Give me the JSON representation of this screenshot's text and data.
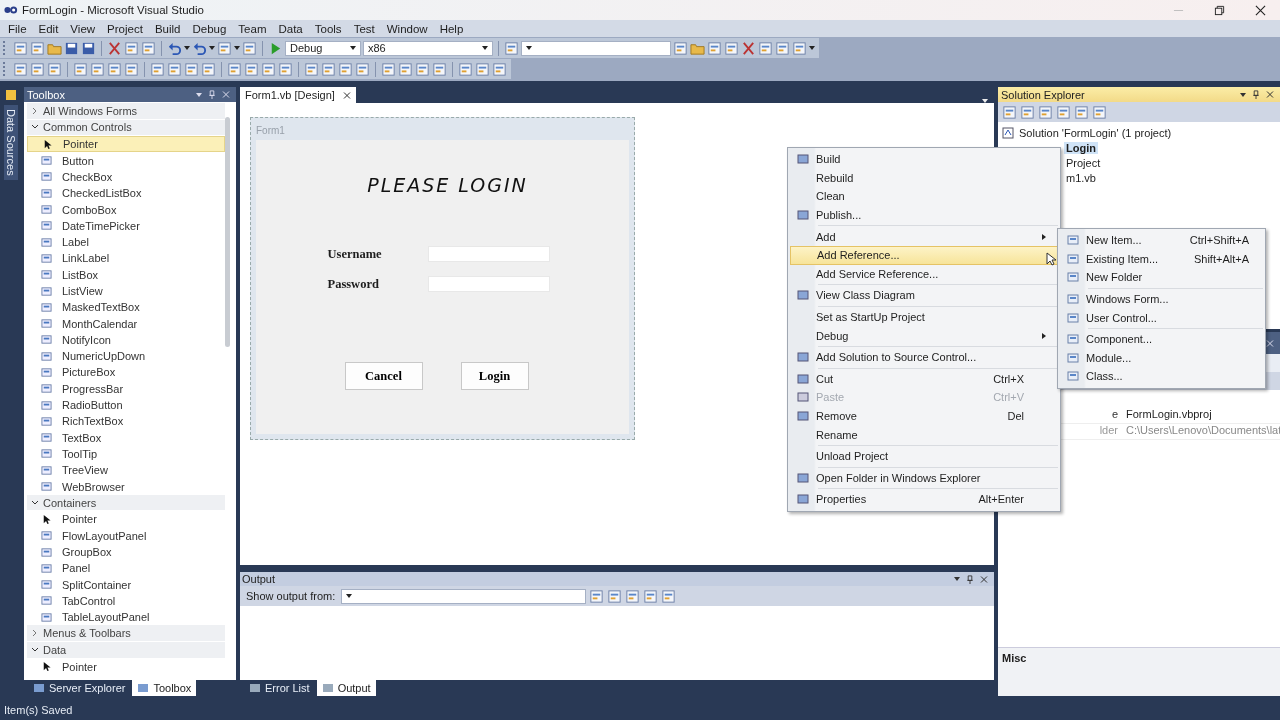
{
  "window": {
    "title": "FormLogin - Microsoft Visual Studio"
  },
  "menu_bar": [
    "File",
    "Edit",
    "View",
    "Project",
    "Build",
    "Debug",
    "Team",
    "Data",
    "Tools",
    "Test",
    "Window",
    "Help"
  ],
  "toolbar": {
    "configuration": "Debug",
    "platform": "x86"
  },
  "side_strip": {
    "label": "Data Sources"
  },
  "toolbox": {
    "title": "Toolbox",
    "groups": [
      {
        "label": "All Windows Forms",
        "expanded": false
      },
      {
        "label": "Common Controls",
        "expanded": true,
        "items": [
          {
            "label": "Pointer",
            "selected": true
          },
          {
            "label": "Button",
            "selected": false
          },
          {
            "label": "CheckBox",
            "selected": false
          },
          {
            "label": "CheckedListBox",
            "selected": false
          },
          {
            "label": "ComboBox",
            "selected": false
          },
          {
            "label": "DateTimePicker",
            "selected": false
          },
          {
            "label": "Label",
            "selected": false
          },
          {
            "label": "LinkLabel",
            "selected": false
          },
          {
            "label": "ListBox",
            "selected": false
          },
          {
            "label": "ListView",
            "selected": false
          },
          {
            "label": "MaskedTextBox",
            "selected": false
          },
          {
            "label": "MonthCalendar",
            "selected": false
          },
          {
            "label": "NotifyIcon",
            "selected": false
          },
          {
            "label": "NumericUpDown",
            "selected": false
          },
          {
            "label": "PictureBox",
            "selected": false
          },
          {
            "label": "ProgressBar",
            "selected": false
          },
          {
            "label": "RadioButton",
            "selected": false
          },
          {
            "label": "RichTextBox",
            "selected": false
          },
          {
            "label": "TextBox",
            "selected": false
          },
          {
            "label": "ToolTip",
            "selected": false
          },
          {
            "label": "TreeView",
            "selected": false
          },
          {
            "label": "WebBrowser",
            "selected": false
          }
        ]
      },
      {
        "label": "Containers",
        "expanded": true,
        "items": [
          {
            "label": "Pointer",
            "selected": false
          },
          {
            "label": "FlowLayoutPanel",
            "selected": false
          },
          {
            "label": "GroupBox",
            "selected": false
          },
          {
            "label": "Panel",
            "selected": false
          },
          {
            "label": "SplitContainer",
            "selected": false
          },
          {
            "label": "TabControl",
            "selected": false
          },
          {
            "label": "TableLayoutPanel",
            "selected": false
          }
        ]
      },
      {
        "label": "Menus & Toolbars",
        "expanded": false
      },
      {
        "label": "Data",
        "expanded": true,
        "items": [
          {
            "label": "Pointer",
            "selected": false
          }
        ]
      }
    ]
  },
  "left_tabs": [
    {
      "label": "Server Explorer",
      "selected": false
    },
    {
      "label": "Toolbox",
      "selected": true
    }
  ],
  "document_tabs": [
    {
      "label": "Form1.vb [Design]",
      "selected": true
    }
  ],
  "form": {
    "title": "Form1",
    "heading": "PLEASE LOGIN",
    "fields": [
      {
        "label": "Username"
      },
      {
        "label": "Password"
      }
    ],
    "buttons": [
      "Cancel",
      "Login"
    ]
  },
  "output": {
    "title": "Output",
    "show_from_label": "Show output from:"
  },
  "bottom_tabs": [
    {
      "label": "Error List",
      "selected": false
    },
    {
      "label": "Output",
      "selected": true
    }
  ],
  "solution_explorer": {
    "title": "Solution Explorer",
    "tree": [
      {
        "label": "Solution 'FormLogin' (1 project)",
        "selected": false,
        "children": [
          {
            "label": "Login",
            "selected": true,
            "children": [
              {
                "label": "Project",
                "selected": false
              },
              {
                "label": "m1.vb",
                "selected": false
              }
            ]
          }
        ]
      }
    ]
  },
  "properties": {
    "rows": [
      {
        "name": "e",
        "value": "FormLogin.vbproj"
      },
      {
        "name": "lder",
        "value": "C:\\Users\\Lenovo\\Documents\\lat"
      }
    ],
    "category": "Misc"
  },
  "context_menu": {
    "items": [
      {
        "kind": "item",
        "label": "Build",
        "has_icon": true,
        "submenu": false,
        "selected": false,
        "disabled": false
      },
      {
        "kind": "item",
        "label": "Rebuild",
        "has_icon": false,
        "submenu": false,
        "selected": false,
        "disabled": false
      },
      {
        "kind": "item",
        "label": "Clean",
        "has_icon": false,
        "submenu": false,
        "selected": false,
        "disabled": false
      },
      {
        "kind": "item",
        "label": "Publish...",
        "has_icon": true,
        "submenu": false,
        "selected": false,
        "disabled": false
      },
      {
        "kind": "separator"
      },
      {
        "kind": "item",
        "label": "Add",
        "has_icon": false,
        "submenu": true,
        "selected": false,
        "disabled": false
      },
      {
        "kind": "item",
        "label": "Add Reference...",
        "has_icon": false,
        "submenu": false,
        "selected": true,
        "disabled": false
      },
      {
        "kind": "item",
        "label": "Add Service Reference...",
        "has_icon": false,
        "submenu": false,
        "selected": false,
        "disabled": false
      },
      {
        "kind": "separator"
      },
      {
        "kind": "item",
        "label": "View Class Diagram",
        "has_icon": true,
        "submenu": false,
        "selected": false,
        "disabled": false
      },
      {
        "kind": "separator"
      },
      {
        "kind": "item",
        "label": "Set as StartUp Project",
        "has_icon": false,
        "submenu": false,
        "selected": false,
        "disabled": false
      },
      {
        "kind": "item",
        "label": "Debug",
        "has_icon": false,
        "submenu": true,
        "selected": false,
        "disabled": false
      },
      {
        "kind": "separator"
      },
      {
        "kind": "item",
        "label": "Add Solution to Source Control...",
        "has_icon": true,
        "submenu": false,
        "selected": false,
        "disabled": false
      },
      {
        "kind": "separator"
      },
      {
        "kind": "item",
        "label": "Cut",
        "shortcut": "Ctrl+X",
        "has_icon": true,
        "submenu": false,
        "selected": false,
        "disabled": false
      },
      {
        "kind": "item",
        "label": "Paste",
        "shortcut": "Ctrl+V",
        "has_icon": true,
        "submenu": false,
        "selected": false,
        "disabled": true
      },
      {
        "kind": "item",
        "label": "Remove",
        "shortcut": "Del",
        "has_icon": true,
        "submenu": false,
        "selected": false,
        "disabled": false
      },
      {
        "kind": "item",
        "label": "Rename",
        "has_icon": false,
        "submenu": false,
        "selected": false,
        "disabled": false
      },
      {
        "kind": "separator"
      },
      {
        "kind": "item",
        "label": "Unload Project",
        "has_icon": false,
        "submenu": false,
        "selected": false,
        "disabled": false
      },
      {
        "kind": "separator"
      },
      {
        "kind": "item",
        "label": "Open Folder in Windows Explorer",
        "has_icon": true,
        "submenu": false,
        "selected": false,
        "disabled": false
      },
      {
        "kind": "separator"
      },
      {
        "kind": "item",
        "label": "Properties",
        "shortcut": "Alt+Enter",
        "has_icon": true,
        "submenu": false,
        "selected": false,
        "disabled": false
      }
    ]
  },
  "submenu": {
    "items": [
      {
        "kind": "item",
        "label": "New Item...",
        "shortcut": "Ctrl+Shift+A"
      },
      {
        "kind": "item",
        "label": "Existing Item...",
        "shortcut": "Shift+Alt+A"
      },
      {
        "kind": "item",
        "label": "New Folder"
      },
      {
        "kind": "separator"
      },
      {
        "kind": "item",
        "label": "Windows Form..."
      },
      {
        "kind": "item",
        "label": "User Control..."
      },
      {
        "kind": "separator"
      },
      {
        "kind": "item",
        "label": "Component..."
      },
      {
        "kind": "item",
        "label": "Module..."
      },
      {
        "kind": "item",
        "label": "Class..."
      }
    ]
  },
  "status_bar": {
    "text": "Item(s) Saved"
  }
}
